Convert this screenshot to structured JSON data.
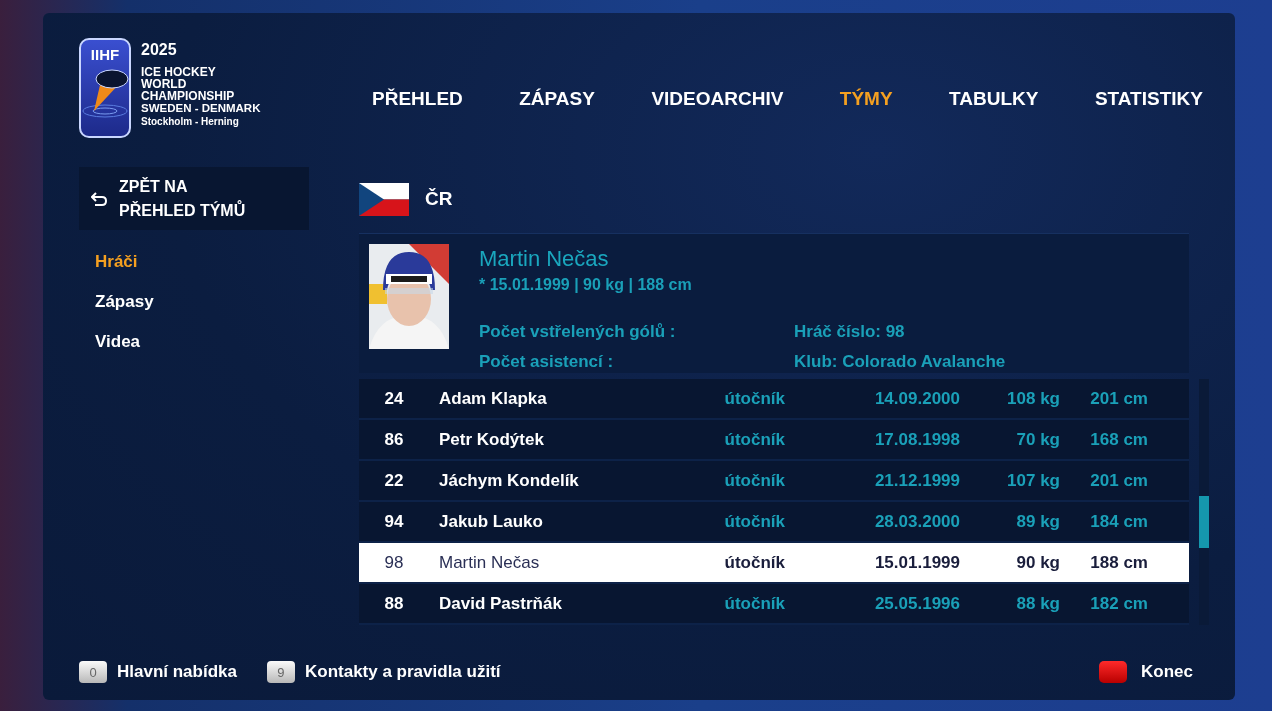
{
  "logo": {
    "mark": "IIHF",
    "year": "2025",
    "lines": [
      "ICE HOCKEY",
      "WORLD",
      "CHAMPIONSHIP",
      "SWEDEN - DENMARK",
      "Stockholm - Herning"
    ]
  },
  "nav": [
    {
      "label": "PŘEHLED",
      "selected": false
    },
    {
      "label": "ZÁPASY",
      "selected": false
    },
    {
      "label": "VIDEOARCHIV",
      "selected": false
    },
    {
      "label": "TÝMY",
      "selected": true
    },
    {
      "label": "TABULKY",
      "selected": false
    },
    {
      "label": "STATISTIKY",
      "selected": false
    }
  ],
  "back_button": {
    "label": "ZPĚT NA PŘEHLED TÝMŮ"
  },
  "sidebar": {
    "items": [
      {
        "label": "Hráči",
        "selected": true
      },
      {
        "label": "Zápasy",
        "selected": false
      },
      {
        "label": "Videa",
        "selected": false
      }
    ]
  },
  "team": {
    "name": "ČR"
  },
  "player": {
    "photo": {
      "kind": "picture"
    },
    "name": "Martin Nečas",
    "details": "* 15.01.1999 | 90 kg | 188 cm",
    "stats": [
      "Počet vstřelených gólů :",
      "Hráč číslo: 98",
      "Počet asistencí :",
      "Klub: Colorado Avalanche"
    ]
  },
  "table": {
    "rows": [
      {
        "cells": [
          "24",
          "Adam Klapka",
          "útočník",
          "14.09.2000",
          "108 kg",
          "201 cm"
        ],
        "selected": false
      },
      {
        "cells": [
          "86",
          "Petr Kodýtek",
          "útočník",
          "17.08.1998",
          "70 kg",
          "168 cm"
        ],
        "selected": false
      },
      {
        "cells": [
          "22",
          "Jáchym Kondelík",
          "útočník",
          "21.12.1999",
          "107 kg",
          "201 cm"
        ],
        "selected": false
      },
      {
        "cells": [
          "94",
          "Jakub Lauko",
          "útočník",
          "28.03.2000",
          "89 kg",
          "184 cm"
        ],
        "selected": false
      },
      {
        "cells": [
          "98",
          "Martin Nečas",
          "útočník",
          "15.01.1999",
          "90 kg",
          "188 cm"
        ],
        "selected": true
      },
      {
        "cells": [
          "88",
          "David Pastrňák",
          "útočník",
          "25.05.1996",
          "88 kg",
          "182 cm"
        ],
        "selected": false
      }
    ]
  },
  "footer": {
    "keys": [
      {
        "kind": "number",
        "key": "0",
        "label": "Hlavní nabídka"
      },
      {
        "kind": "number",
        "key": "9",
        "label": "Kontakty a pravidla užití"
      },
      {
        "kind": "red",
        "label": "Konec"
      }
    ]
  }
}
